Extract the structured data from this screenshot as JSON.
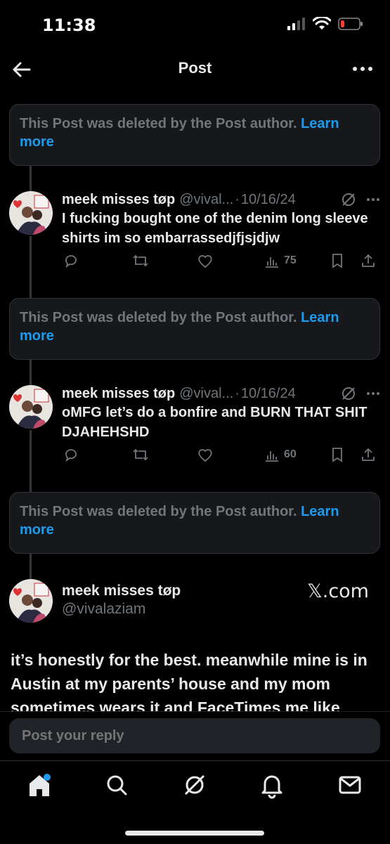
{
  "status_bar": {
    "time": "11:38"
  },
  "nav": {
    "title": "Post"
  },
  "deleted_notice": {
    "text": "This Post was deleted by the Post author. ",
    "link": "Learn more"
  },
  "replies": [
    {
      "author": "meek misses tøp",
      "handle": "@vival...",
      "date": "10/16/24",
      "text": "I fucking bought one of the denim long sleeve shirts im so embarrassedjfjsjdjw",
      "views": "75"
    },
    {
      "author": "meek misses tøp",
      "handle": "@vival...",
      "date": "10/16/24",
      "text": "oMFG let’s do a bonfire and BURN THAT SHIT DJAHEHSHD",
      "views": "60"
    }
  ],
  "main_post": {
    "author": "meek misses tøp",
    "handle": "@vivalaziam",
    "watermark": "𝕏.com",
    "text": "it’s honestly for the best. meanwhile mine is in Austin at my parents’ house and my mom sometimes wears it and FaceTimes me like"
  },
  "reply_box": {
    "placeholder": "Post your reply"
  },
  "colors": {
    "background": "#000000",
    "accent": "#1d9bf0",
    "muted": "#71767b",
    "text": "#e7e9ea"
  },
  "icons": [
    "back-arrow-icon",
    "more-icon",
    "reply-icon",
    "repost-icon",
    "like-icon",
    "views-icon",
    "bookmark-icon",
    "share-icon",
    "grok-icon",
    "home-icon",
    "search-icon",
    "notifications-icon",
    "messages-icon"
  ]
}
